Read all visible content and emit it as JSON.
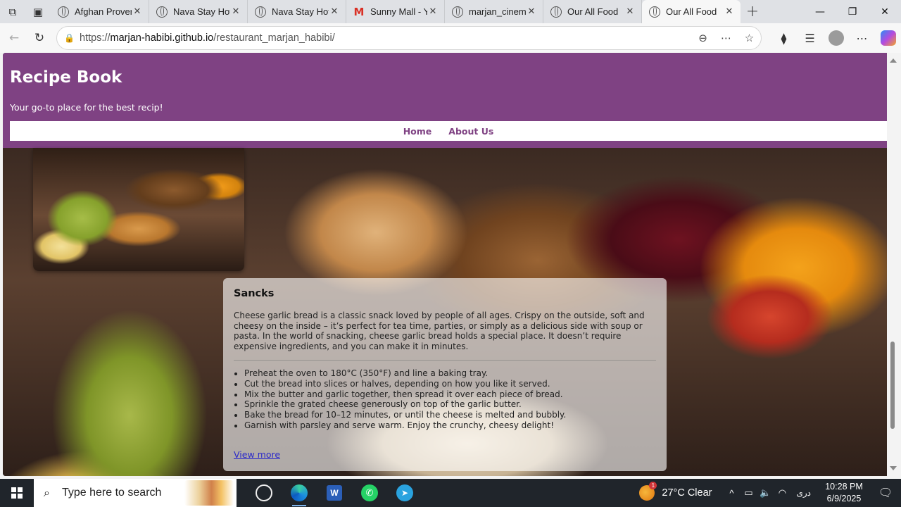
{
  "browser": {
    "tabs": [
      {
        "title": "Afghan Proverb",
        "icon": "globe-icon"
      },
      {
        "title": "Nava Stay Hotel",
        "icon": "globe-icon"
      },
      {
        "title": "Nava Stay Hotel",
        "icon": "globe-icon"
      },
      {
        "title": "Sunny Mall - Yo",
        "icon": "gmail-icon"
      },
      {
        "title": "marjan_cinema",
        "icon": "globe-icon"
      },
      {
        "title": "Our All Food",
        "icon": "globe-icon"
      },
      {
        "title": "Our All Food",
        "icon": "globe-icon",
        "active": true
      }
    ],
    "url_prefix": "https://",
    "url_host": "marjan-habibi.github.io",
    "url_path": "/restaurant_marjan_habibi/"
  },
  "site": {
    "title": "Recipe Book",
    "subtitle": "Your go-to place for the best recip!",
    "nav": {
      "home": "Home",
      "about": "About Us"
    },
    "brand_color": "#7f4283"
  },
  "card": {
    "title": "Sancks",
    "description": "Cheese garlic bread is a classic snack loved by people of all ages. Crispy on the outside, soft and cheesy on the inside – it’s perfect for tea time, parties, or simply as a delicious side with soup or pasta. In the world of snacking, cheese garlic bread holds a special place. It doesn’t require expensive ingredients, and you can make it in minutes.",
    "steps": [
      "Preheat the oven to 180°C (350°F) and line a baking tray.",
      "Cut the bread into slices or halves, depending on how you like it served.",
      "Mix the butter and garlic together, then spread it over each piece of bread.",
      "Sprinkle the grated cheese generously on top of the garlic butter.",
      "Bake the bread for 10–12 minutes, or until the cheese is melted and bubbly.",
      "Garnish with parsley and serve warm. Enjoy the crunchy, cheesy delight!"
    ],
    "more_link": "View more"
  },
  "taskbar": {
    "search_placeholder": "Type here to search",
    "weather": "27°C  Clear",
    "weather_badge": "1",
    "lang": "دری",
    "time": "10:28 PM",
    "date": "6/9/2025"
  }
}
